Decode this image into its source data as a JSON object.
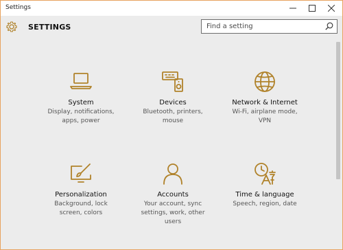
{
  "window": {
    "title": "Settings",
    "minimize_label": "—",
    "maximize_label": "☐",
    "close_label": "✕"
  },
  "header": {
    "title": "SETTINGS"
  },
  "search": {
    "placeholder": "Find a setting"
  },
  "colors": {
    "accent": "#b0822a",
    "window_border": "#e8a25e",
    "background": "#ececec"
  },
  "tiles": [
    {
      "icon": "laptop-icon",
      "label": "System",
      "desc": [
        "Display, notifications,",
        "apps, power"
      ]
    },
    {
      "icon": "devices-icon",
      "label": "Devices",
      "desc": [
        "Bluetooth, printers,",
        "mouse"
      ]
    },
    {
      "icon": "globe-icon",
      "label": "Network & Internet",
      "desc": [
        "Wi-Fi, airplane mode,",
        "VPN"
      ]
    },
    {
      "icon": "personalization-icon",
      "label": "Personalization",
      "desc": [
        "Background, lock",
        "screen, colors"
      ]
    },
    {
      "icon": "person-icon",
      "label": "Accounts",
      "desc": [
        "Your account, sync",
        "settings, work, other",
        "users"
      ]
    },
    {
      "icon": "time-language-icon",
      "label": "Time & language",
      "desc": [
        "Speech, region, date"
      ]
    }
  ]
}
